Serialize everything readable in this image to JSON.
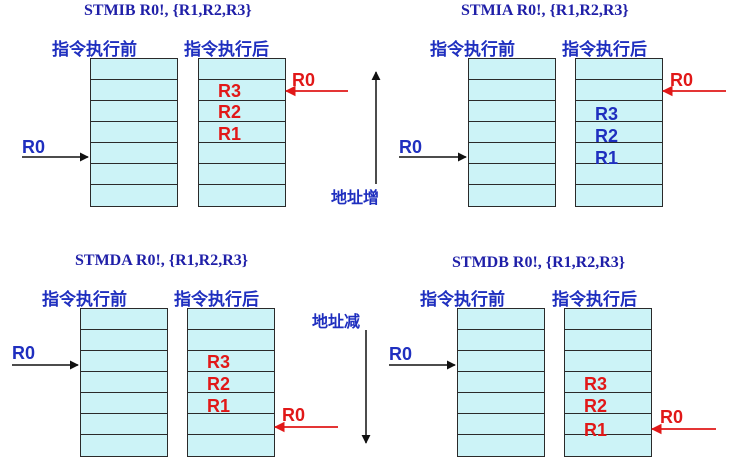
{
  "colors": {
    "title": "#1f1fa8",
    "heading": "#1f2fbf",
    "stack_fill": "#ccf3f7",
    "red": "#e11818",
    "blue": "#1f2fbf"
  },
  "panels": [
    {
      "id": "stmib",
      "title": "STMIB R0!, {R1,R2,R3}",
      "before": "指令执行前",
      "after": "指令执行后",
      "before_pointer": "R0",
      "after_pointer": "R0",
      "regs": [
        "R3",
        "R2",
        "R1"
      ],
      "reg_color": "red"
    },
    {
      "id": "stmia",
      "title": "STMIA R0!, {R1,R2,R3}",
      "before": "指令执行前",
      "after": "指令执行后",
      "before_pointer": "R0",
      "after_pointer": "R0",
      "regs": [
        "R3",
        "R2",
        "R1"
      ],
      "reg_color": "blue"
    },
    {
      "id": "stmda",
      "title": "STMDA R0!, {R1,R2,R3}",
      "before": "指令执行前",
      "after": "指令执行后",
      "before_pointer": "R0",
      "after_pointer": "R0",
      "regs": [
        "R3",
        "R2",
        "R1"
      ],
      "reg_color": "red"
    },
    {
      "id": "stmdb",
      "title": "STMDB R0!, {R1,R2,R3}",
      "before": "指令执行前",
      "after": "指令执行后",
      "before_pointer": "R0",
      "after_pointer": "R0",
      "regs": [
        "R3",
        "R2",
        "R1"
      ],
      "reg_color": "red"
    }
  ],
  "address_increase": "地址增",
  "address_decrease": "地址减"
}
